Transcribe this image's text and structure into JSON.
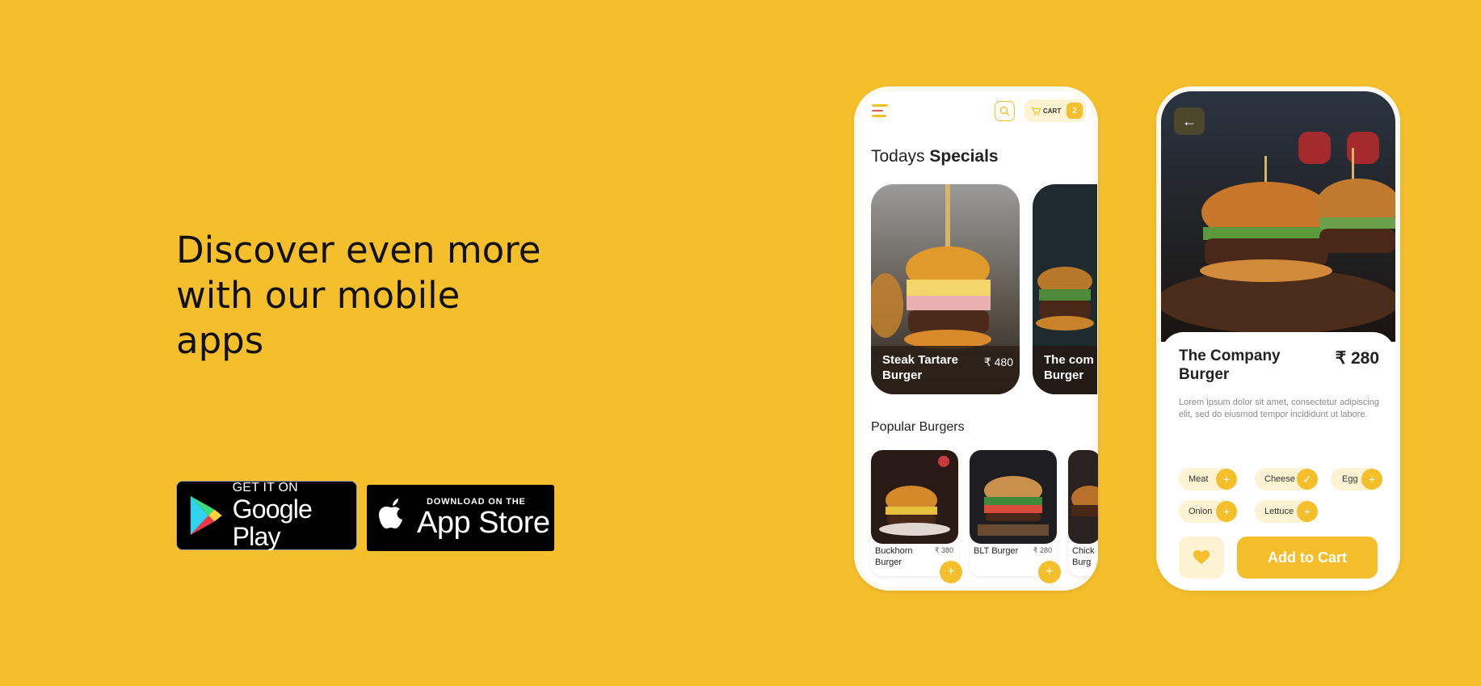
{
  "hero": {
    "title": "Discover even more with our mobile apps"
  },
  "badges": {
    "google_play": {
      "small": "GET IT ON",
      "big": "Google Play"
    },
    "app_store": {
      "small": "DOWNLOAD ON THE",
      "big": "App Store"
    }
  },
  "phone_home": {
    "cart_label": "CART",
    "cart_count": "2",
    "specials_title_light": "Todays",
    "specials_title_bold": "Specials",
    "specials": [
      {
        "name": "Steak Tartare Burger",
        "price": "₹ 480"
      },
      {
        "name": "The com Burger"
      }
    ],
    "popular_title": "Popular Burgers",
    "popular": [
      {
        "name": "Buckhorn Burger",
        "price": "₹ 380"
      },
      {
        "name": "BLT Burger",
        "price": "₹ 280"
      },
      {
        "name": "Chick Burg"
      }
    ],
    "icons": [
      "menu-icon",
      "search-icon",
      "cart-icon",
      "plus-icon"
    ]
  },
  "phone_detail": {
    "name": "The Company Burger",
    "price": "₹ 280",
    "description": "Lorem ipsum dolor sit amet, consectetur adipiscing elit, sed do eiusmod tempor incididunt ut labore.",
    "toppings": [
      {
        "label": "Meat",
        "selected": false
      },
      {
        "label": "Cheese",
        "selected": true
      },
      {
        "label": "Egg",
        "selected": false
      },
      {
        "label": "Onion",
        "selected": false
      },
      {
        "label": "Lettuce",
        "selected": false
      }
    ],
    "add_to_cart": "Add to Cart",
    "icons": [
      "back-arrow-icon",
      "heart-icon",
      "check-icon",
      "plus-icon"
    ]
  },
  "colors": {
    "background": "#F5BE2B",
    "accent": "#F5BE2B",
    "chip": "#FDF3D3"
  }
}
